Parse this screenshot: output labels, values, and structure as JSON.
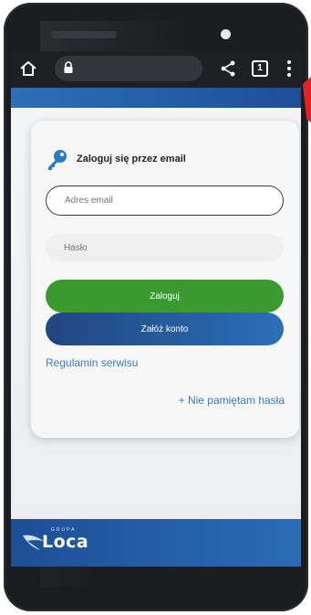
{
  "browser": {
    "tab_count": "1",
    "icons": [
      "home-icon",
      "lock-icon",
      "share-icon",
      "tabs-icon",
      "menu-icon"
    ]
  },
  "login": {
    "title": "Zaloguj się przez email",
    "email_placeholder": "Adres email",
    "password_placeholder": "Hasło",
    "login_label": "Zaloguj",
    "register_label": "Załóż konto",
    "terms_label": "Regulamin serwisu",
    "forgot_label": "+ Nie pamiętam hasła"
  },
  "footer": {
    "logo_name": "Loca",
    "logo_top": "GRUPA"
  },
  "colors": {
    "brand_blue": "#2c6fb7",
    "dark_blue": "#20467f",
    "login_green": "#3a9a2f",
    "link_blue": "#3a7ab8"
  }
}
